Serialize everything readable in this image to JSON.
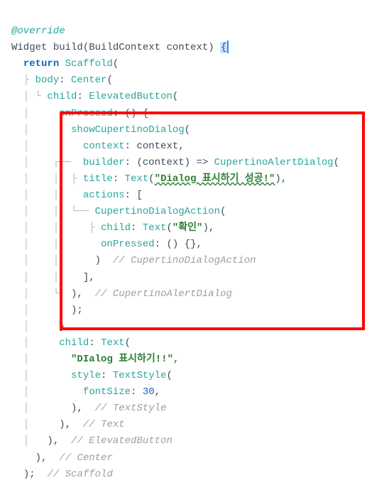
{
  "code": {
    "override": "@override",
    "widget": "Widget",
    "build": "build",
    "buildParams": "(BuildContext context) ",
    "brace": "{",
    "return": "return",
    "Scaffold": "Scaffold",
    "body": "body",
    "Center": "Center",
    "child": "child",
    "ElevatedButton": "ElevatedButton",
    "onPressed": "onPressed",
    "anonOpen": ": () {",
    "showCupertinoDialog": "showCupertinoDialog",
    "context": "context",
    "contextVal": ": context,",
    "builder": "builder",
    "builderLambda": ": (context) => ",
    "CupertinoAlertDialog": "CupertinoAlertDialog",
    "title": "title",
    "Text": "Text",
    "strDialogSuccess": "\"Dialog 표시하기 성공!\"",
    "actions": "actions",
    "actionsOpen": ": [",
    "CupertinoDialogAction": "CupertinoDialogAction",
    "strConfirm": "\"확인\"",
    "onPressedEmpty": ": () {},",
    "closeParenCupertinoDialogAction": ")",
    "cmtCupertinoDialogAction": "// CupertinoDialogAction",
    "closeBracket": "],",
    "closeCupertinoAlertDialog": "),",
    "cmtCupertinoAlertDialog": "// CupertinoAlertDialog",
    "closeShowCall": ");",
    "closeAnon": "},",
    "childText": "child",
    "strDialogShow": "\"DIalog 표시하기!!\"",
    "style": "style",
    "TextStyle": "TextStyle",
    "fontSize": "fontSize",
    "num30": "30",
    "closeTextStyle": "),",
    "cmtTextStyle": "// TextStyle",
    "closeText": "),",
    "cmtText": "// Text",
    "closeElevatedButton": "),",
    "cmtElevatedButton": "// ElevatedButton",
    "closeCenter": "),",
    "cmtCenter": "// Center",
    "closeScaffold": ");",
    "cmtScaffold": "// Scaffold"
  }
}
